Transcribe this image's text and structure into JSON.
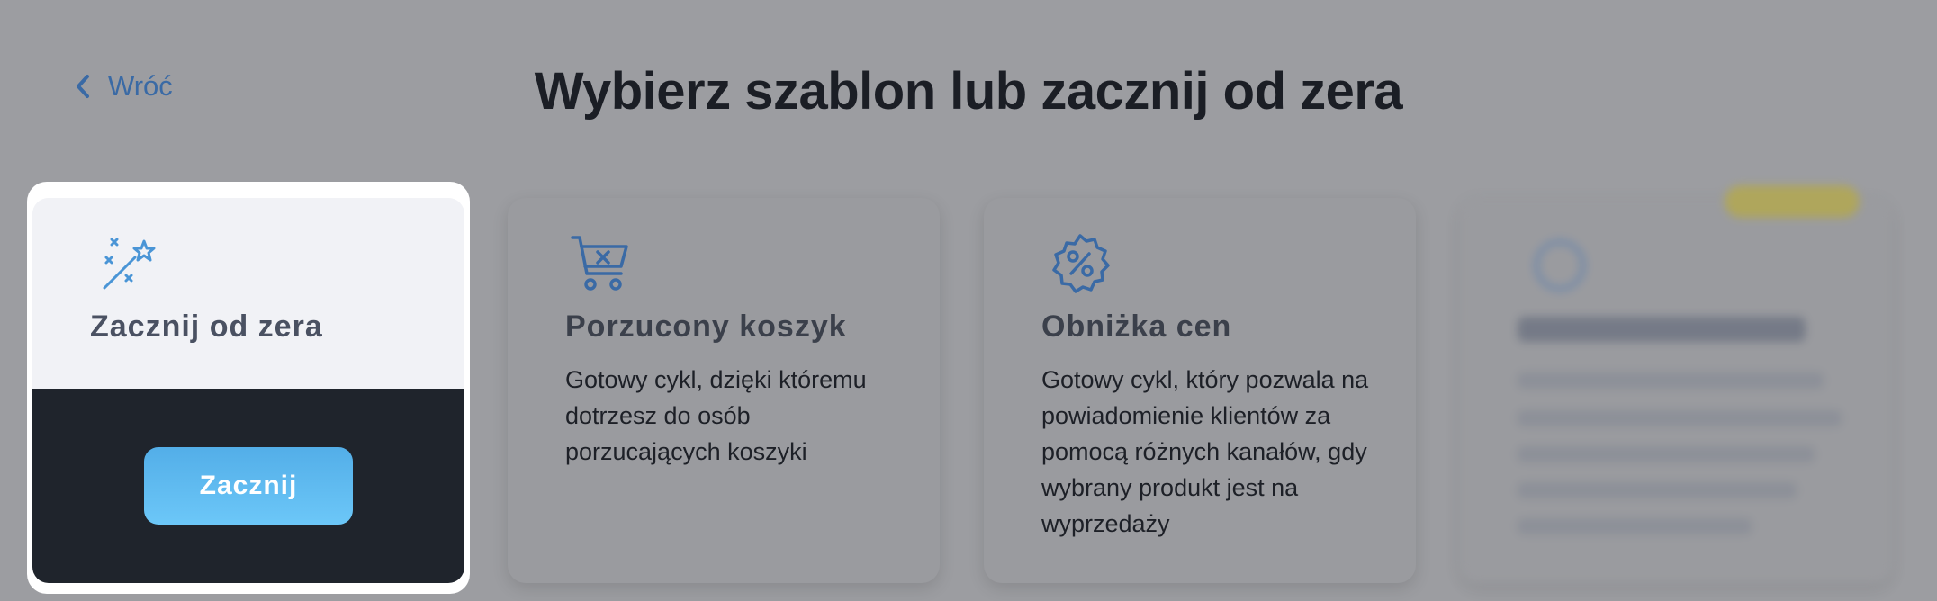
{
  "header": {
    "back_label": "Wróć",
    "title": "Wybierz szablon lub zacznij od zera"
  },
  "start_card": {
    "title": "Zacznij od zera",
    "button_label": "Zacznij",
    "icon": "magic-wand-icon"
  },
  "templates": [
    {
      "title": "Porzucony koszyk",
      "description": "Gotowy cykl, dzięki któremu dotrzesz do osób porzucających koszyki",
      "icon": "cart-x-icon"
    },
    {
      "title": "Obniżka cen",
      "description": "Gotowy cykl, który pozwala na powiadomienie klientów za pomocą różnych kanałów, gdy wybrany produkt jest na wyprzedaży",
      "icon": "discount-badge-icon"
    }
  ],
  "colors": {
    "accent": "#3a6aa5",
    "button": "#5bb8f0",
    "dark_panel": "#1f242c"
  }
}
